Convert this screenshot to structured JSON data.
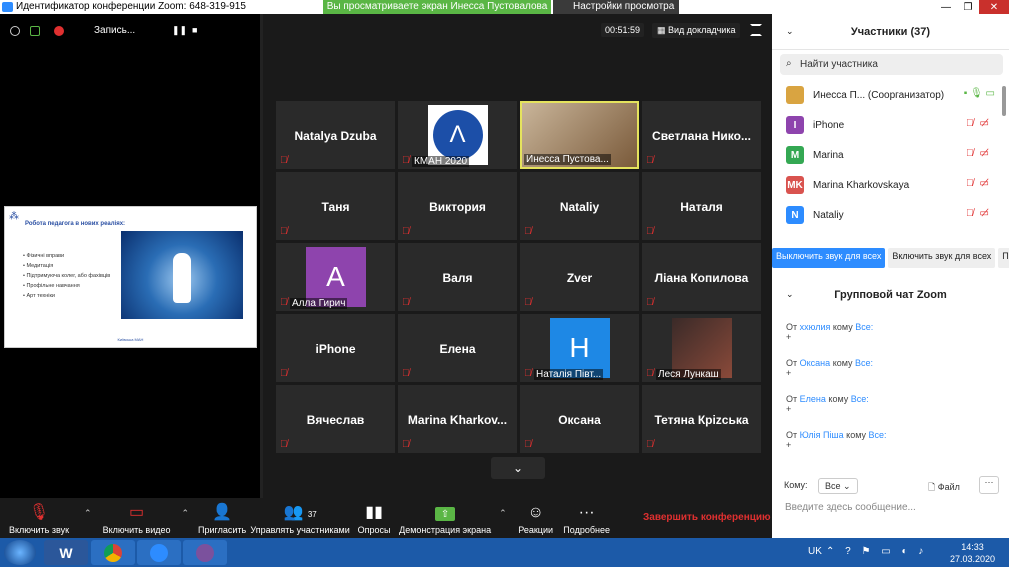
{
  "titlebar": {
    "title": "Идентификатор конференции Zoom: 648-319-915",
    "share_banner": "Вы просматриваете экран Инесса Пустовалова",
    "view_options": "Настройки просмотра",
    "window_buttons": [
      "—",
      "❐",
      "✕"
    ]
  },
  "top_controls": {
    "recording_label": "Запись..."
  },
  "shared_slide": {
    "title": "Робота педагога в нових реаліях:",
    "bullets": [
      "Фізичні вправи",
      "Медитація",
      "Підтримуюча колег, або фахівців",
      "Профільне навчання",
      "Арт техніки"
    ],
    "footer": "Київська МАН"
  },
  "meeting": {
    "timer": "00:51:59",
    "speaker_view": "Вид докладчика"
  },
  "tiles": [
    {
      "name": "Natalya  Dzuba",
      "type": "name"
    },
    {
      "name": "",
      "type": "logo",
      "sub": "КМАН 2020"
    },
    {
      "name": "",
      "type": "photo",
      "sub": "Инесса Пустова...",
      "active": true
    },
    {
      "name": "Светлана  Нико...",
      "type": "name"
    },
    {
      "name": "Таня",
      "type": "name"
    },
    {
      "name": "Виктория",
      "type": "name"
    },
    {
      "name": "Nataliy",
      "type": "name"
    },
    {
      "name": "Наталя",
      "type": "name"
    },
    {
      "name": "",
      "type": "avatar",
      "letter": "А",
      "color": "#8e44ad",
      "sub": "Алла Гирич"
    },
    {
      "name": "Валя",
      "type": "name"
    },
    {
      "name": "Zver",
      "type": "name"
    },
    {
      "name": "Ліана Копилова",
      "type": "name"
    },
    {
      "name": "iPhone",
      "type": "name"
    },
    {
      "name": "Елена",
      "type": "name"
    },
    {
      "name": "",
      "type": "avatar",
      "letter": "H",
      "color": "#1e88e5",
      "sub": "Наталія Півт..."
    },
    {
      "name": "",
      "type": "photo2",
      "sub": "Леся Лункаш"
    },
    {
      "name": "Вячеслав",
      "type": "name"
    },
    {
      "name": "Marina  Kharkov...",
      "type": "name"
    },
    {
      "name": "Оксана",
      "type": "name"
    },
    {
      "name": "Тетяна Крizська",
      "type": "name"
    }
  ],
  "participants": {
    "title": "Участники (37)",
    "search_placeholder": "Найти участника",
    "list": [
      {
        "initials": "",
        "name": "Инесса П... (Соорганизатор)",
        "color": "#d9a441"
      },
      {
        "initials": "I",
        "name": "iPhone",
        "color": "#8e44ad"
      },
      {
        "initials": "M",
        "name": "Marina",
        "color": "#34a853"
      },
      {
        "initials": "MK",
        "name": "Marina Kharkovskaya",
        "color": "#d9534f"
      },
      {
        "initials": "N",
        "name": "Nataliy",
        "color": "#2d8cff"
      }
    ],
    "mute_all": "Выключить звук для всех",
    "unmute_all": "Включить звук для всех",
    "more": "П"
  },
  "chat": {
    "title": "Групповой чат Zoom",
    "messages": [
      {
        "from_prefix": "От",
        "from": "xxюлия",
        "to_prefix": "кому",
        "to": "Все:",
        "body": "+"
      },
      {
        "from_prefix": "От",
        "from": "Оксана",
        "to_prefix": "кому",
        "to": "Все:",
        "body": "+"
      },
      {
        "from_prefix": "От",
        "from": "Елена",
        "to_prefix": "кому",
        "to": "Все:",
        "body": "+"
      },
      {
        "from_prefix": "От",
        "from": "Юлія Піша",
        "to_prefix": "кому",
        "to": "Все:",
        "body": "+"
      }
    ],
    "to_label": "Кому:",
    "to_value": "Все",
    "file_label": "Файл",
    "input_placeholder": "Введите здесь сообщение..."
  },
  "toolbar": {
    "unmute": "Включить звук",
    "start_video": "Включить видео",
    "invite": "Пригласить",
    "manage_participants": "Управлять участниками",
    "participant_count": "37",
    "polls": "Опросы",
    "share_screen": "Демонстрация экрана",
    "reactions": "Реакции",
    "more": "Подробнее",
    "end": "Завершить конференцию"
  },
  "taskbar": {
    "language": "UK",
    "time": "14:33",
    "date": "27.03.2020"
  }
}
